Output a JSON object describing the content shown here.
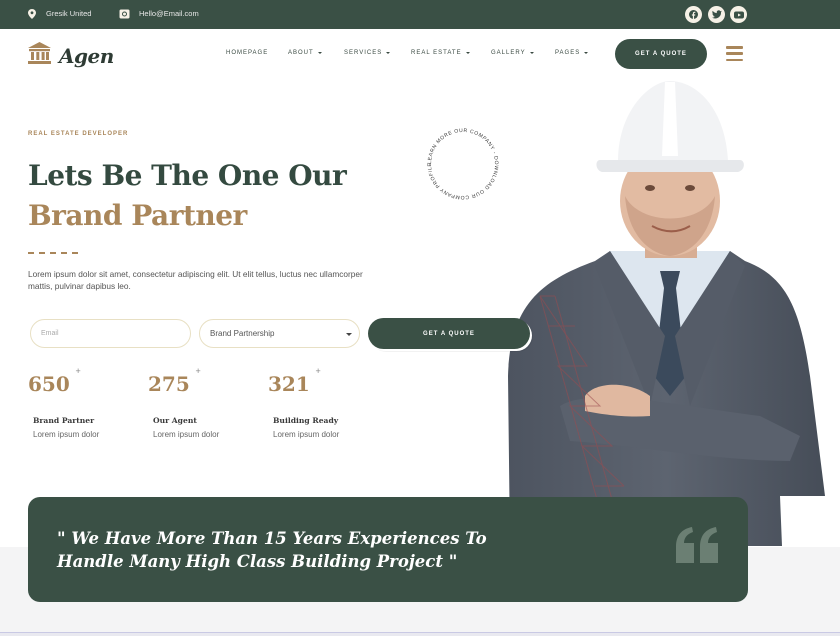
{
  "topbar": {
    "location": "Gresik United",
    "email": "Hello@Email.com",
    "social": [
      "facebook-icon",
      "twitter-icon",
      "youtube-icon"
    ]
  },
  "brand": {
    "name": "Agen"
  },
  "nav": {
    "items": [
      {
        "label": "HOMEPAGE",
        "dropdown": false
      },
      {
        "label": "ABOUT",
        "dropdown": true
      },
      {
        "label": "SERVICES",
        "dropdown": true
      },
      {
        "label": "REAL ESTATE",
        "dropdown": true
      },
      {
        "label": "GALLERY",
        "dropdown": true
      },
      {
        "label": "PAGES",
        "dropdown": true
      }
    ],
    "cta": "GET A QUOTE"
  },
  "hero": {
    "eyebrow": "REAL ESTATE DEVELOPER",
    "title_line1": "Lets Be The One Our",
    "title_line2": "Brand Partner",
    "description": "Lorem ipsum dolor sit amet, consectetur adipiscing elit. Ut elit tellus, luctus nec ullamcorper mattis, pulvinar dapibus leo.",
    "form": {
      "email_placeholder": "Email",
      "select_value": "Brand Partnership",
      "submit": "GET A QUOTE"
    },
    "badge_text": "LEARN MORE OUR COMPANY - DOWNLOAD OUR COMPANY PROFILE NOW -",
    "stats": [
      {
        "value": "650",
        "suffix": "+",
        "label": "Brand Partner",
        "sub": "Lorem ipsum dolor"
      },
      {
        "value": "275",
        "suffix": "+",
        "label": "Our Agent",
        "sub": "Lorem ipsum dolor"
      },
      {
        "value": "321",
        "suffix": "+",
        "label": "Building Ready",
        "sub": "Lorem ipsum dolor"
      }
    ]
  },
  "quote": {
    "line1": "\" We Have More Than 15 Years Experiences To",
    "line2": "Handle Many High Class Building Project \""
  },
  "colors": {
    "primary": "#3a5045",
    "accent": "#a9865a",
    "cream": "#f6f1e6"
  }
}
